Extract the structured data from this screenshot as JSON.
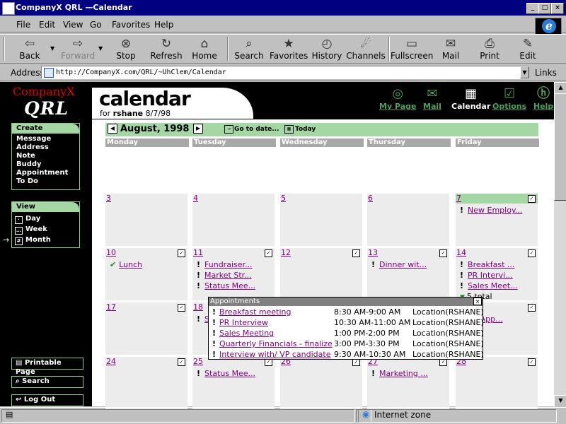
{
  "window": {
    "title": "CompanyX QRL —Calendar",
    "controls": [
      "_",
      "□",
      "×"
    ]
  },
  "menu": [
    "File",
    "Edit",
    "View",
    "Go",
    "Favorites",
    "Help"
  ],
  "toolbar": [
    {
      "label": "Back",
      "icon": "back-arrow-icon",
      "glyph": "⇦",
      "enabled": true
    },
    {
      "label": "Forward",
      "icon": "forward-arrow-icon",
      "glyph": "⇨",
      "enabled": false
    },
    {
      "label": "Stop",
      "icon": "stop-icon",
      "glyph": "⊗",
      "enabled": true
    },
    {
      "label": "Refresh",
      "icon": "refresh-icon",
      "glyph": "↻",
      "enabled": true
    },
    {
      "label": "Home",
      "icon": "home-icon",
      "glyph": "⌂",
      "enabled": true
    },
    {
      "label": "Search",
      "icon": "search-icon",
      "glyph": "⌕",
      "enabled": true
    },
    {
      "label": "Favorites",
      "icon": "favorites-icon",
      "glyph": "★",
      "enabled": true
    },
    {
      "label": "History",
      "icon": "history-icon",
      "glyph": "◴",
      "enabled": true
    },
    {
      "label": "Channels",
      "icon": "channels-icon",
      "glyph": "☄",
      "enabled": true
    },
    {
      "label": "Fullscreen",
      "icon": "fullscreen-icon",
      "glyph": "▭",
      "enabled": true
    },
    {
      "label": "Mail",
      "icon": "mail-icon",
      "glyph": "✉",
      "enabled": true
    },
    {
      "label": "Print",
      "icon": "print-icon",
      "glyph": "⎙",
      "enabled": true
    },
    {
      "label": "Edit",
      "icon": "edit-icon",
      "glyph": "✎",
      "enabled": true
    }
  ],
  "address": {
    "label": "Address",
    "url": "http://CompanyX.com/QRL/~UhClem/Calendar",
    "links": "Links"
  },
  "brand": {
    "line1": "CompanyX",
    "line2": "QRL"
  },
  "header": {
    "title": "calendar",
    "subtitle_prefix": "for",
    "user": "rshane",
    "date": "8/7/98"
  },
  "nav": [
    {
      "label": "My Page",
      "icon": "target-icon",
      "glyph": "◎",
      "current": false
    },
    {
      "label": "Mail",
      "icon": "mail-icon",
      "glyph": "✉",
      "current": false
    },
    {
      "label": "Calendar",
      "icon": "calendar-icon",
      "glyph": "▦",
      "current": true
    },
    {
      "label": "Options",
      "icon": "checkbox-icon",
      "glyph": "☑",
      "current": false
    },
    {
      "label": "Help",
      "icon": "help-icon",
      "glyph": "ⓗ",
      "current": false
    }
  ],
  "sidebar": {
    "create_title": "Create",
    "create_items": [
      "Message",
      "Address",
      "Note",
      "Buddy",
      "Appointment",
      "To Do"
    ],
    "view_title": "View",
    "view_items": [
      {
        "label": "Day",
        "glyph": "·"
      },
      {
        "label": "Week",
        "glyph": "…"
      },
      {
        "label": "Month",
        "glyph": "#"
      }
    ],
    "printable": "Printable Page",
    "search": "Search",
    "logout": "Log Out"
  },
  "calendar": {
    "month": "August, 1998",
    "goto": "Go to date...",
    "today": "Today",
    "days": [
      "Monday",
      "Tuesday",
      "Wednesday",
      "Thursday",
      "Friday"
    ],
    "weeks": [
      [
        {
          "d": ""
        },
        {
          "d": ""
        },
        {
          "d": ""
        },
        {
          "d": ""
        },
        {
          "d": ""
        }
      ],
      [
        {
          "d": "3"
        },
        {
          "d": "4"
        },
        {
          "d": "5"
        },
        {
          "d": "6"
        },
        {
          "d": "7",
          "today": true,
          "events": [
            "New Employ..."
          ]
        }
      ],
      [
        {
          "d": "10",
          "events": [
            "Lunch"
          ],
          "done": true
        },
        {
          "d": "11",
          "events": [
            "Fundraiser...",
            "Market Str...",
            "Status Mee..."
          ]
        },
        {
          "d": "12"
        },
        {
          "d": "13",
          "events": [
            "Dinner wit..."
          ]
        },
        {
          "d": "14",
          "events": [
            "Breakfast ...",
            "PR Intervi...",
            "Sales Meet..."
          ],
          "total": "5 total"
        }
      ],
      [
        {
          "d": "17"
        },
        {
          "d": "18",
          "events": [
            "S"
          ]
        },
        {
          "d": ""
        },
        {
          "d": ""
        },
        {
          "d": "",
          "events": [
            "tal App..."
          ]
        }
      ],
      [
        {
          "d": "24"
        },
        {
          "d": "25",
          "events": [
            "Status Mee..."
          ]
        },
        {
          "d": "26"
        },
        {
          "d": "27",
          "events": [
            "Marketing ..."
          ]
        },
        {
          "d": "28"
        }
      ]
    ]
  },
  "popup": {
    "title": "Appointments",
    "close": "×",
    "rows": [
      {
        "title": "Breakfast meeting",
        "time": "8:30 AM-9:00 AM",
        "location": "Location(RSHANE)"
      },
      {
        "title": "PR Interview",
        "time": "10:30 AM-11:00 AM",
        "location": "Location(RSHANE)"
      },
      {
        "title": "Sales Meeting",
        "time": "1:00 PM-2:00 PM",
        "location": "Location(RSHANE)"
      },
      {
        "title": "Quarterly Financials - finalize",
        "time": "3:00 PM-3:30 PM",
        "location": "Location(RSHANE)"
      },
      {
        "title": "Interview with/ VP candidate",
        "time": "9:30 AM-10:30 AM",
        "location": "Location(RSHANE)"
      }
    ]
  },
  "status": {
    "zone": "Internet zone"
  }
}
